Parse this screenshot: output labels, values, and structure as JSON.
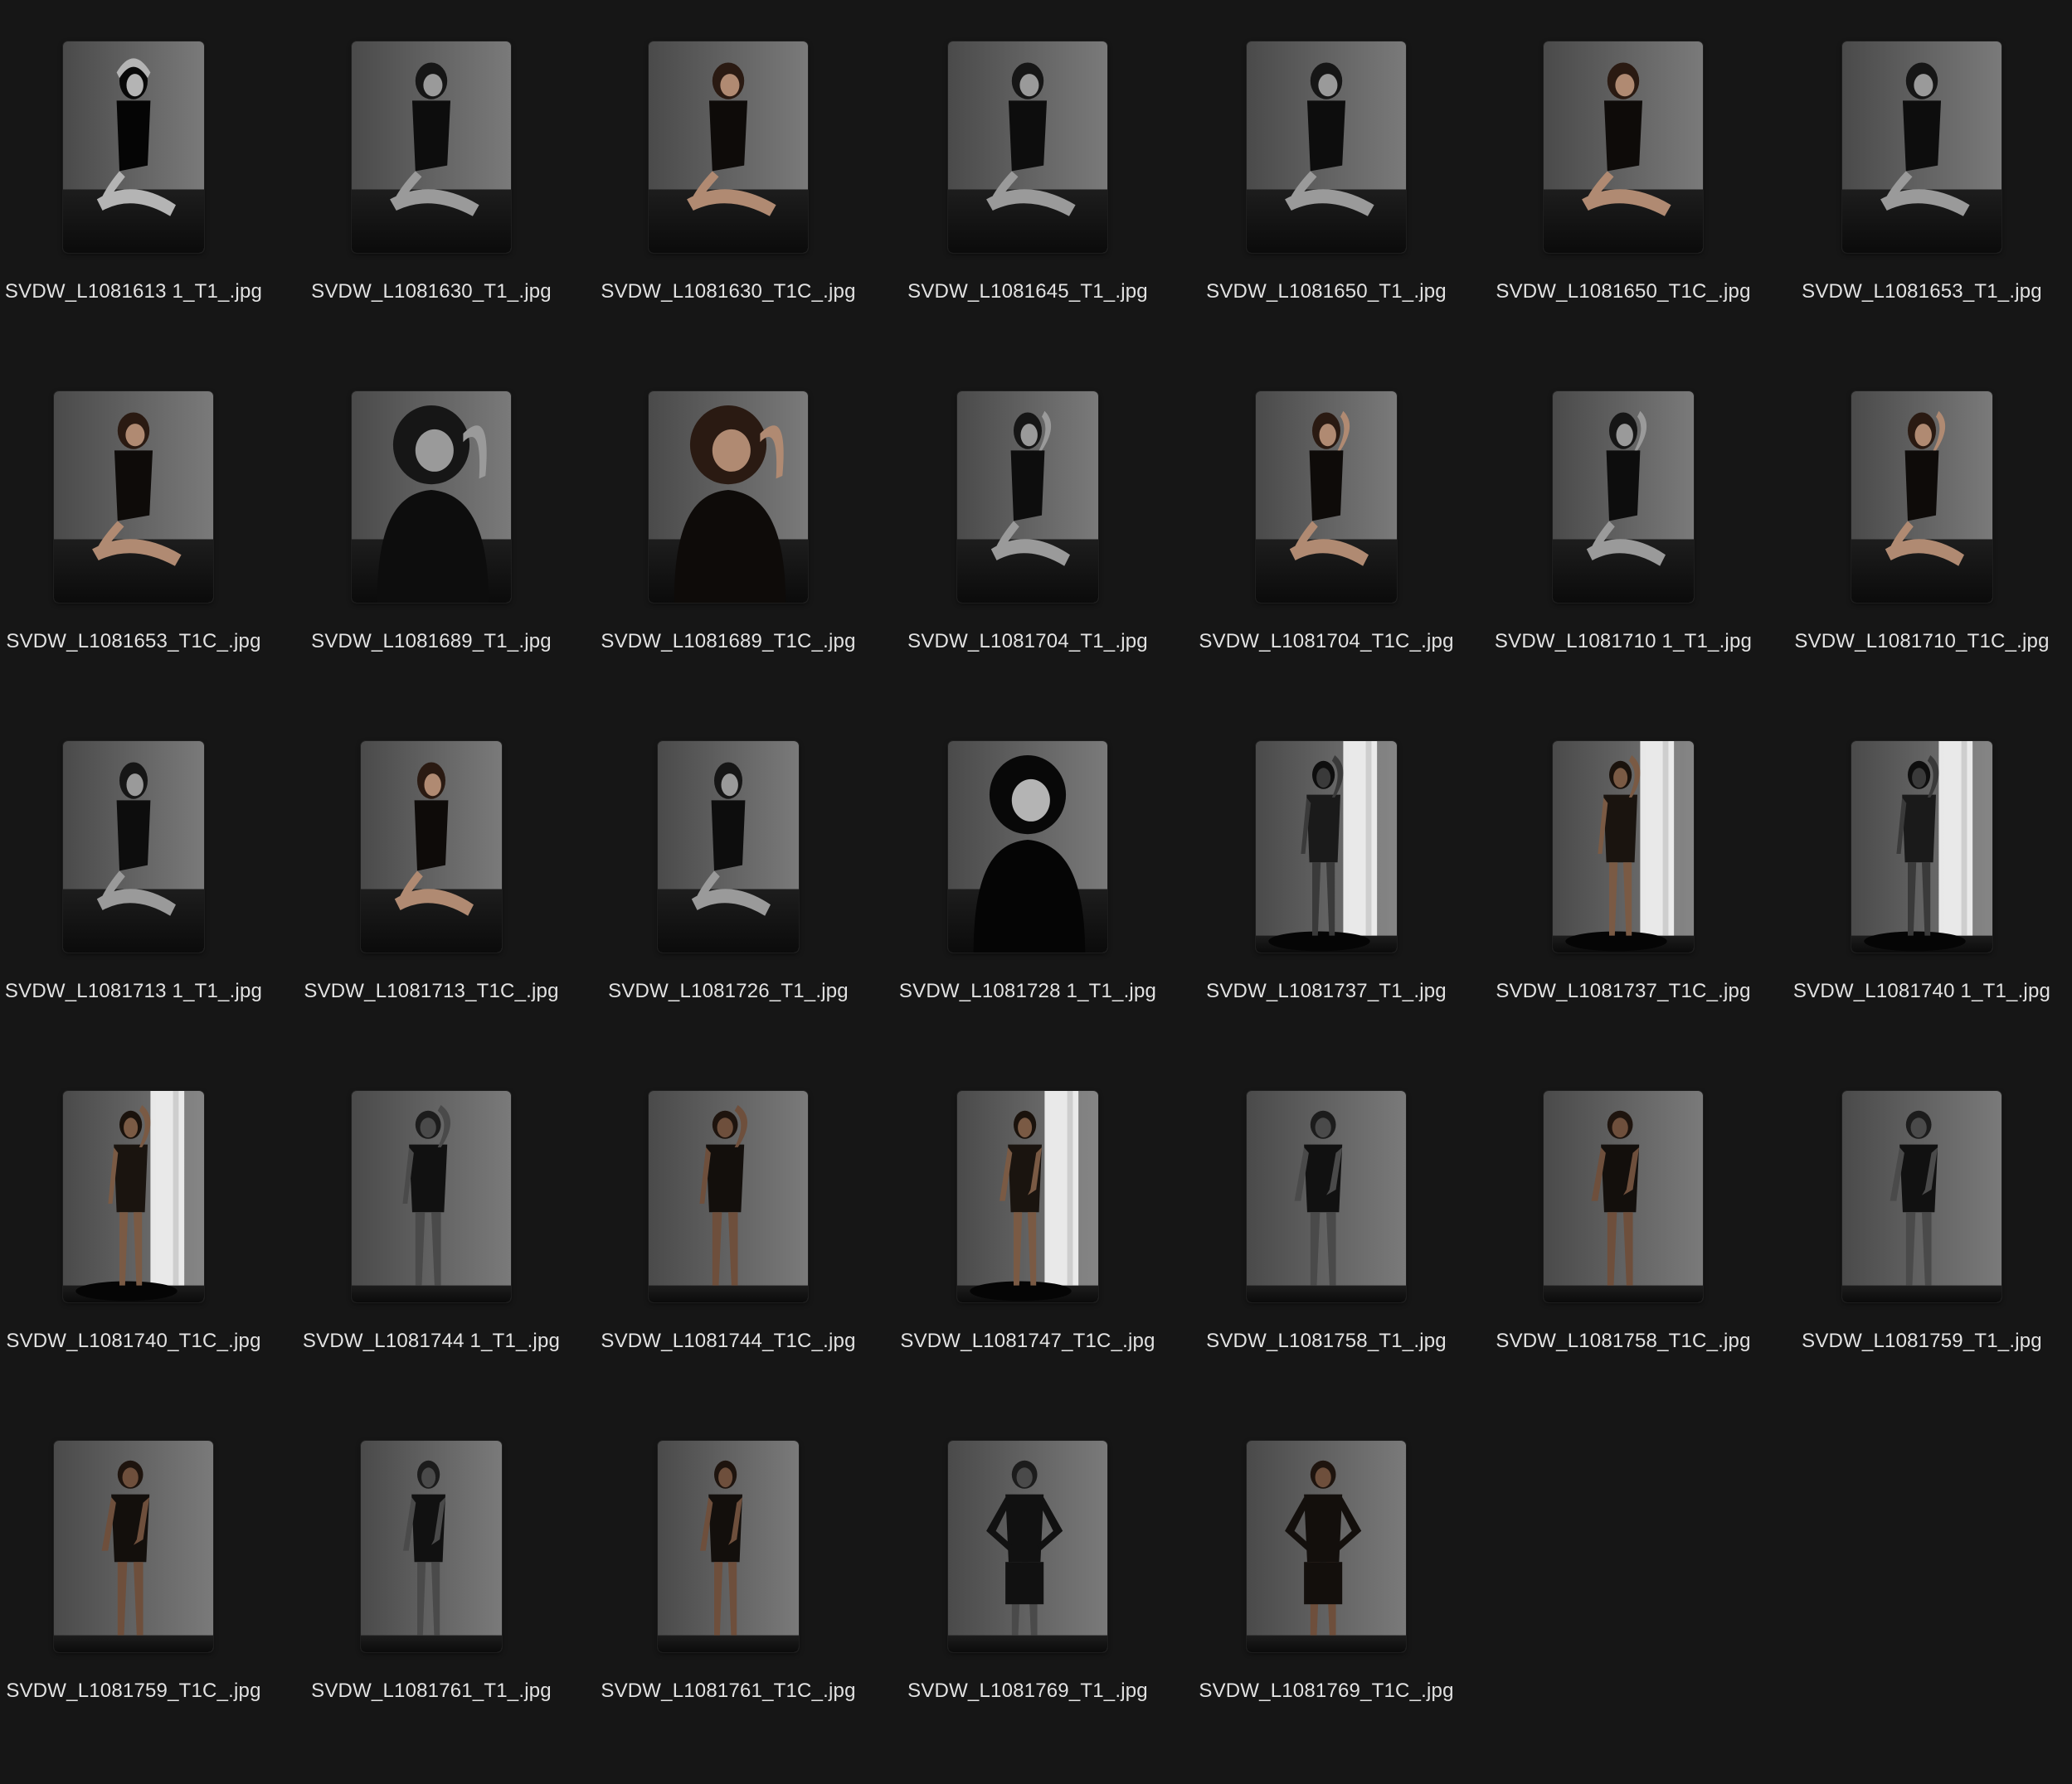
{
  "files": [
    {
      "name": "SVDW_L1081613 1_T1_.jpg",
      "tone": "bw-dark",
      "pose": "arms-up-kneel",
      "shape": "narrow"
    },
    {
      "name": "SVDW_L1081630_T1_.jpg",
      "tone": "bw",
      "pose": "sit-side",
      "shape": "wide"
    },
    {
      "name": "SVDW_L1081630_T1C_.jpg",
      "tone": "color",
      "pose": "sit-side",
      "shape": "wide"
    },
    {
      "name": "SVDW_L1081645_T1_.jpg",
      "tone": "bw",
      "pose": "sit-cross",
      "shape": "wide"
    },
    {
      "name": "SVDW_L1081650_T1_.jpg",
      "tone": "bw",
      "pose": "sit-cross",
      "shape": "wide"
    },
    {
      "name": "SVDW_L1081650_T1C_.jpg",
      "tone": "color",
      "pose": "sit-cross",
      "shape": "wide"
    },
    {
      "name": "SVDW_L1081653_T1_.jpg",
      "tone": "bw",
      "pose": "sit-cross",
      "shape": "wide"
    },
    {
      "name": "SVDW_L1081653_T1C_.jpg",
      "tone": "color",
      "pose": "sit-cross",
      "shape": "wide"
    },
    {
      "name": "SVDW_L1081689_T1_.jpg",
      "tone": "bw",
      "pose": "closeup-arm",
      "shape": "wide"
    },
    {
      "name": "SVDW_L1081689_T1C_.jpg",
      "tone": "color",
      "pose": "closeup-arm",
      "shape": "wide"
    },
    {
      "name": "SVDW_L1081704_T1_.jpg",
      "tone": "bw",
      "pose": "sit-arm",
      "shape": "narrow"
    },
    {
      "name": "SVDW_L1081704_T1C_.jpg",
      "tone": "color",
      "pose": "sit-arm",
      "shape": "narrow"
    },
    {
      "name": "SVDW_L1081710 1_T1_.jpg",
      "tone": "bw",
      "pose": "sit-arm",
      "shape": "narrow"
    },
    {
      "name": "SVDW_L1081710_T1C_.jpg",
      "tone": "color",
      "pose": "sit-arm",
      "shape": "narrow"
    },
    {
      "name": "SVDW_L1081713 1_T1_.jpg",
      "tone": "bw",
      "pose": "sit-cross",
      "shape": "narrow"
    },
    {
      "name": "SVDW_L1081713_T1C_.jpg",
      "tone": "color",
      "pose": "sit-cross",
      "shape": "narrow"
    },
    {
      "name": "SVDW_L1081726_T1_.jpg",
      "tone": "bw",
      "pose": "sit-side",
      "shape": "narrow"
    },
    {
      "name": "SVDW_L1081728 1_T1_.jpg",
      "tone": "bw-dark",
      "pose": "closeup",
      "shape": "wide"
    },
    {
      "name": "SVDW_L1081737_T1_.jpg",
      "tone": "bw-window",
      "pose": "stand-arm",
      "shape": "narrow"
    },
    {
      "name": "SVDW_L1081737_T1C_.jpg",
      "tone": "color-window",
      "pose": "stand-arm",
      "shape": "narrow"
    },
    {
      "name": "SVDW_L1081740 1_T1_.jpg",
      "tone": "bw-window",
      "pose": "stand-arm",
      "shape": "narrow"
    },
    {
      "name": "SVDW_L1081740_T1C_.jpg",
      "tone": "color-window",
      "pose": "stand-arm",
      "shape": "narrow"
    },
    {
      "name": "SVDW_L1081744 1_T1_.jpg",
      "tone": "bw-light",
      "pose": "stand-arm",
      "shape": "wide"
    },
    {
      "name": "SVDW_L1081744_T1C_.jpg",
      "tone": "color-light",
      "pose": "stand-arm",
      "shape": "wide"
    },
    {
      "name": "SVDW_L1081747_T1C_.jpg",
      "tone": "color-window",
      "pose": "stand",
      "shape": "narrow"
    },
    {
      "name": "SVDW_L1081758_T1_.jpg",
      "tone": "bw-light",
      "pose": "stand",
      "shape": "wide"
    },
    {
      "name": "SVDW_L1081758_T1C_.jpg",
      "tone": "color-light",
      "pose": "stand",
      "shape": "wide"
    },
    {
      "name": "SVDW_L1081759_T1_.jpg",
      "tone": "bw-light",
      "pose": "stand",
      "shape": "wide"
    },
    {
      "name": "SVDW_L1081759_T1C_.jpg",
      "tone": "color-light",
      "pose": "stand",
      "shape": "wide"
    },
    {
      "name": "SVDW_L1081761_T1_.jpg",
      "tone": "bw-light",
      "pose": "stand",
      "shape": "narrow"
    },
    {
      "name": "SVDW_L1081761_T1C_.jpg",
      "tone": "color-light",
      "pose": "stand",
      "shape": "narrow"
    },
    {
      "name": "SVDW_L1081769_T1_.jpg",
      "tone": "bw-light",
      "pose": "hands-hips",
      "shape": "wide"
    },
    {
      "name": "SVDW_L1081769_T1C_.jpg",
      "tone": "color-light",
      "pose": "hands-hips",
      "shape": "wide"
    }
  ],
  "colors": {
    "background": "#161616",
    "label": "#e2e2e2"
  }
}
